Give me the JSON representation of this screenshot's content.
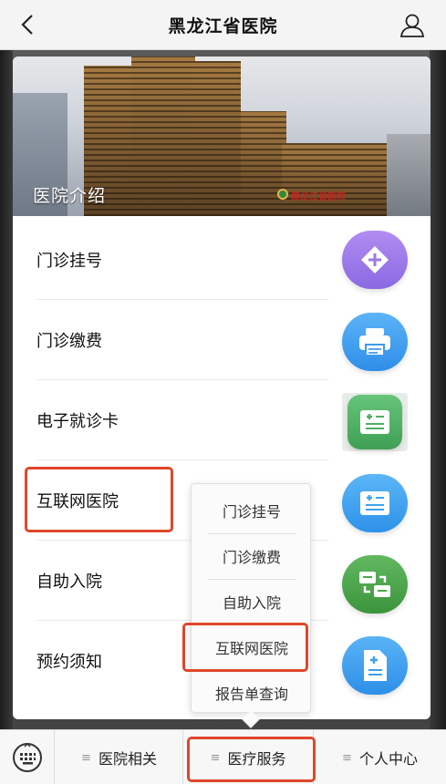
{
  "header": {
    "title": "黑龙江省医院",
    "back_icon": "chevron-left-icon",
    "user_icon": "user-icon"
  },
  "banner": {
    "label": "医院介绍",
    "sign": "黑龙江省医院"
  },
  "menu": [
    {
      "label": "门诊挂号",
      "icon": "plus-diamond-icon",
      "color": "#9b7be8"
    },
    {
      "label": "门诊缴费",
      "icon": "printer-icon",
      "color": "#3d9bf0"
    },
    {
      "label": "电子就诊卡",
      "icon": "card-plus-icon",
      "color": "#4caf62"
    },
    {
      "label": "互联网医院",
      "icon": "card-plus-icon",
      "color": "#3aa3ef"
    },
    {
      "label": "自助入院",
      "icon": "transfer-icon",
      "color": "#4aa84a"
    },
    {
      "label": "预约须知",
      "icon": "document-plus-icon",
      "color": "#3aa0ec"
    }
  ],
  "popup": {
    "items": [
      "门诊挂号",
      "门诊缴费",
      "自助入院",
      "互联网医院",
      "报告单查询"
    ]
  },
  "tabbar": {
    "keyboard_icon": "keyboard-icon",
    "tabs": [
      {
        "label": "医院相关"
      },
      {
        "label": "医疗服务"
      },
      {
        "label": "个人中心"
      }
    ]
  },
  "colors": {
    "highlight": "#e0462a"
  }
}
